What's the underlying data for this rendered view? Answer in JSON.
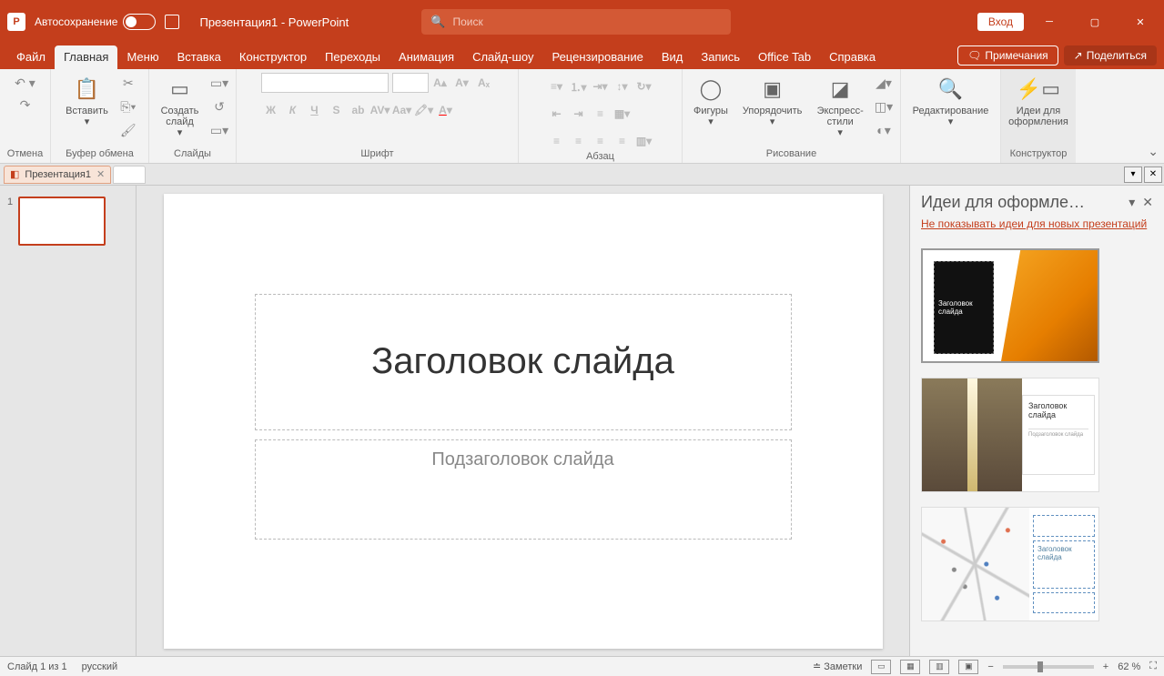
{
  "titlebar": {
    "autosave_label": "Автосохранение",
    "doc_title": "Презентация1 - PowerPoint",
    "search_placeholder": "Поиск",
    "login": "Вход"
  },
  "tabs": {
    "file": "Файл",
    "home": "Главная",
    "menu": "Меню",
    "insert": "Вставка",
    "design": "Конструктор",
    "transitions": "Переходы",
    "animations": "Анимация",
    "slideshow": "Слайд-шоу",
    "review": "Рецензирование",
    "view": "Вид",
    "record": "Запись",
    "officetab": "Office Tab",
    "help": "Справка",
    "comments": "Примечания",
    "share": "Поделиться"
  },
  "ribbon": {
    "undo_group": "Отмена",
    "clipboard_group": "Буфер обмена",
    "paste": "Вставить",
    "slides_group": "Слайды",
    "new_slide": "Создать слайд",
    "font_group": "Шрифт",
    "paragraph_group": "Абзац",
    "drawing_group": "Рисование",
    "shapes": "Фигуры",
    "arrange": "Упорядочить",
    "quickstyles": "Экспресс-стили",
    "editing_group": "Редактирование",
    "designer_group": "Конструктор",
    "design_ideas": "Идеи для оформления"
  },
  "doctab": {
    "name": "Презентация1"
  },
  "slide": {
    "number": "1",
    "title_placeholder": "Заголовок слайда",
    "subtitle_placeholder": "Подзаголовок слайда"
  },
  "designpane": {
    "title": "Идеи для оформле…",
    "dont_show_link": "Не показывать идеи для новых презентаций",
    "thumb1_title": "Заголовок слайда",
    "thumb2_title": "Заголовок слайда",
    "thumb2_sub": "Подзаголовок слайда",
    "thumb3_title": "Заголовок слайда"
  },
  "statusbar": {
    "slide_count": "Слайд 1 из 1",
    "language": "русский",
    "notes": "Заметки",
    "zoom": "62 %"
  }
}
